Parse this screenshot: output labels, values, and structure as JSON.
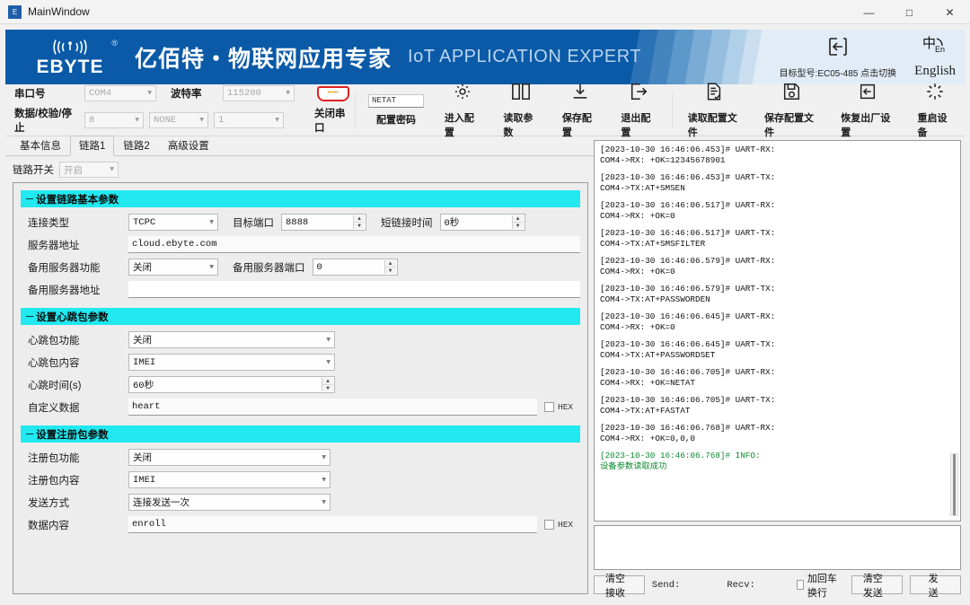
{
  "window": {
    "title": "MainWindow",
    "icon": "app-icon",
    "minimize": "—",
    "maximize": "□",
    "close": "✕"
  },
  "banner": {
    "logo_text": "EBYTE",
    "logo_reg": "®",
    "title_cn": "亿佰特・物联网应用专家",
    "title_en": "IoT APPLICATION EXPERT",
    "model_switch": "目标型号:EC05-485 点击切换",
    "language": "English"
  },
  "toolbar": {
    "port_label": "串口号",
    "port_value": "COM4",
    "baud_label": "波特率",
    "baud_value": "115200",
    "databits_label": "数据/校验/停止",
    "databits_value": "8",
    "parity_value": "NONE",
    "stopbits_value": "1",
    "close_port": "关闭串口",
    "password_value": "NETAT",
    "password_label": "配置密码",
    "enter_config": "进入配置",
    "read_params": "读取参数",
    "save_config": "保存配置",
    "exit_config": "退出配置",
    "read_config_file": "读取配置文件",
    "save_config_file": "保存配置文件",
    "factory_reset": "恢复出厂设置",
    "restart_device": "重启设备"
  },
  "tabs": [
    {
      "label": "基本信息",
      "active": false
    },
    {
      "label": "链路1",
      "active": true
    },
    {
      "label": "链路2",
      "active": false
    },
    {
      "label": "高级设置",
      "active": false
    }
  ],
  "link_switch": {
    "label": "链路开关",
    "value": "开启"
  },
  "group_basic": {
    "title": "设置链路基本参数",
    "conn_type_label": "连接类型",
    "conn_type_value": "TCPC",
    "target_port_label": "目标端口",
    "target_port_value": "8888",
    "short_link_label": "短链接时间",
    "short_link_value": "0秒",
    "server_addr_label": "服务器地址",
    "server_addr_value": "cloud.ebyte.com",
    "backup_fn_label": "备用服务器功能",
    "backup_fn_value": "关闭",
    "backup_port_label": "备用服务器端口",
    "backup_port_value": "0",
    "backup_addr_label": "备用服务器地址",
    "backup_addr_value": ""
  },
  "group_heartbeat": {
    "title": "设置心跳包参数",
    "fn_label": "心跳包功能",
    "fn_value": "关闭",
    "content_label": "心跳包内容",
    "content_value": "IMEI",
    "time_label": "心跳时间(s)",
    "time_value": "60秒",
    "custom_label": "自定义数据",
    "custom_value": "heart",
    "hex_label": "HEX"
  },
  "group_register": {
    "title": "设置注册包参数",
    "fn_label": "注册包功能",
    "fn_value": "关闭",
    "content_label": "注册包内容",
    "content_value": "IMEI",
    "mode_label": "发送方式",
    "mode_value": "连接发送一次",
    "data_label": "数据内容",
    "data_value": "enroll",
    "hex_label": "HEX"
  },
  "log": {
    "entries": [
      {
        "type": "normal",
        "l1": "[2023-10-30 16:46:06.453]# UART-RX:",
        "l2": "COM4->RX: +OK=12345678901"
      },
      {
        "type": "normal",
        "l1": "[2023-10-30 16:46:06.453]# UART-TX:",
        "l2": "COM4->TX:AT+SMSEN"
      },
      {
        "type": "normal",
        "l1": "[2023-10-30 16:46:06.517]# UART-RX:",
        "l2": "COM4->RX: +OK=0"
      },
      {
        "type": "normal",
        "l1": "[2023-10-30 16:46:06.517]# UART-TX:",
        "l2": "COM4->TX:AT+SMSFILTER"
      },
      {
        "type": "normal",
        "l1": "[2023-10-30 16:46:06.579]# UART-RX:",
        "l2": "COM4->RX: +OK=0"
      },
      {
        "type": "normal",
        "l1": "[2023-10-30 16:46:06.579]# UART-TX:",
        "l2": "COM4->TX:AT+PASSWORDEN"
      },
      {
        "type": "normal",
        "l1": "[2023-10-30 16:46:06.645]# UART-RX:",
        "l2": "COM4->RX: +OK=0"
      },
      {
        "type": "normal",
        "l1": "[2023-10-30 16:46:06.645]# UART-TX:",
        "l2": "COM4->TX:AT+PASSWORDSET"
      },
      {
        "type": "normal",
        "l1": "[2023-10-30 16:46:06.705]# UART-RX:",
        "l2": "COM4->RX: +OK=NETAT"
      },
      {
        "type": "normal",
        "l1": "[2023-10-30 16:46:06.705]# UART-TX:",
        "l2": "COM4->TX:AT+FASTAT"
      },
      {
        "type": "normal",
        "l1": "[2023-10-30 16:46:06.768]# UART-RX:",
        "l2": "COM4->RX: +OK=0,0,0"
      },
      {
        "type": "info",
        "l1": "[2023-10-30 16:46:06.768]# INFO:",
        "l2": "设备参数读取成功"
      }
    ]
  },
  "send_bar": {
    "clear_recv": "清空接收",
    "send_stat": "Send:",
    "recv_stat": "Recv:",
    "crlf_label": "加回车换行",
    "clear_send": "清空发送",
    "send": "发送"
  },
  "colors": {
    "brand_blue": "#0a5aa8",
    "group_cyan": "#22e8ef",
    "info_green": "#0a8a2e",
    "accent_red": "#e02020"
  }
}
